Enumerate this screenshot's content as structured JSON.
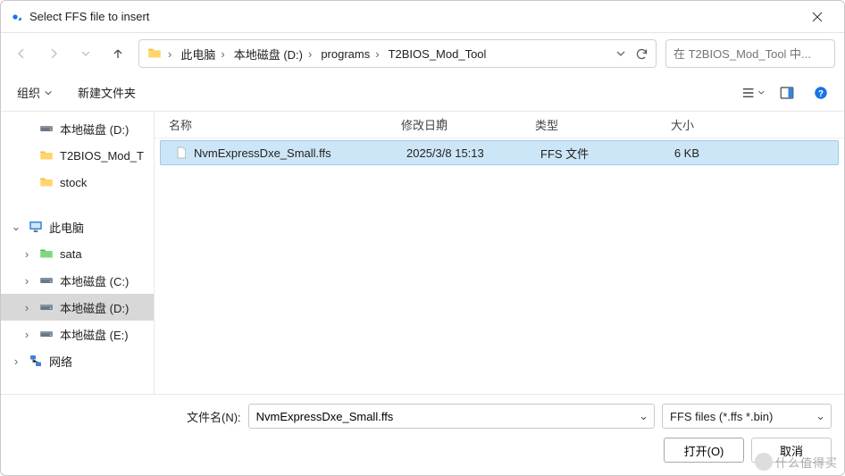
{
  "window": {
    "title": "Select FFS file to insert"
  },
  "nav": {
    "crumbs": [
      "此电脑",
      "本地磁盘 (D:)",
      "programs",
      "T2BIOS_Mod_Tool"
    ]
  },
  "search": {
    "placeholder": "在 T2BIOS_Mod_Tool 中..."
  },
  "toolbar": {
    "organize": "组织",
    "newfolder": "新建文件夹"
  },
  "tree": {
    "items": [
      {
        "icon": "drive",
        "label": "本地磁盘 (D:)",
        "indent": 1,
        "arrow": "",
        "selected": false
      },
      {
        "icon": "folder-y",
        "label": "T2BIOS_Mod_T",
        "indent": 1,
        "arrow": "",
        "selected": false
      },
      {
        "icon": "folder-y",
        "label": "stock",
        "indent": 1,
        "arrow": "",
        "selected": false
      },
      {
        "icon": "spacer",
        "label": "",
        "indent": 0
      },
      {
        "icon": "pc",
        "label": "此电脑",
        "indent": 0,
        "arrow": "down",
        "selected": false
      },
      {
        "icon": "folder-g",
        "label": "sata",
        "indent": 1,
        "arrow": "right",
        "selected": false
      },
      {
        "icon": "drive",
        "label": "本地磁盘 (C:)",
        "indent": 1,
        "arrow": "right",
        "selected": false
      },
      {
        "icon": "drive",
        "label": "本地磁盘 (D:)",
        "indent": 1,
        "arrow": "right",
        "selected": true
      },
      {
        "icon": "drive",
        "label": "本地磁盘 (E:)",
        "indent": 1,
        "arrow": "right",
        "selected": false
      },
      {
        "icon": "network",
        "label": "网络",
        "indent": 0,
        "arrow": "right",
        "selected": false
      }
    ]
  },
  "list": {
    "headers": {
      "name": "名称",
      "modified": "修改日期",
      "type": "类型",
      "size": "大小"
    },
    "rows": [
      {
        "name": "NvmExpressDxe_Small.ffs",
        "modified": "2025/3/8 15:13",
        "type": "FFS 文件",
        "size": "6 KB",
        "selected": true
      }
    ]
  },
  "footer": {
    "filename_label": "文件名(N):",
    "filename_value": "NvmExpressDxe_Small.ffs",
    "filter": "FFS files (*.ffs *.bin)",
    "open": "打开(O)",
    "cancel": "取消"
  },
  "watermark": "什么值得买"
}
